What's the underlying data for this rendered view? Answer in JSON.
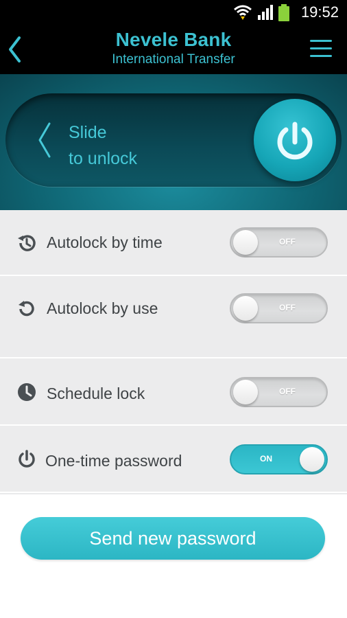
{
  "status_bar": {
    "time": "19:52"
  },
  "header": {
    "title": "Nevele Bank",
    "subtitle": "International Transfer"
  },
  "unlock": {
    "line1": "Slide",
    "line2": "to unlock"
  },
  "settings": [
    {
      "label": "Autolock by time",
      "state": "OFF"
    },
    {
      "label": "Autolock by use",
      "state": "OFF"
    },
    {
      "label": "Schedule lock",
      "state": "OFF"
    },
    {
      "label": "One-time password",
      "state": "ON"
    }
  ],
  "actions": {
    "send_label": "Send new password"
  },
  "colors": {
    "accent": "#3cc1d1",
    "header_bg": "#000000",
    "list_bg": "#ececed"
  }
}
